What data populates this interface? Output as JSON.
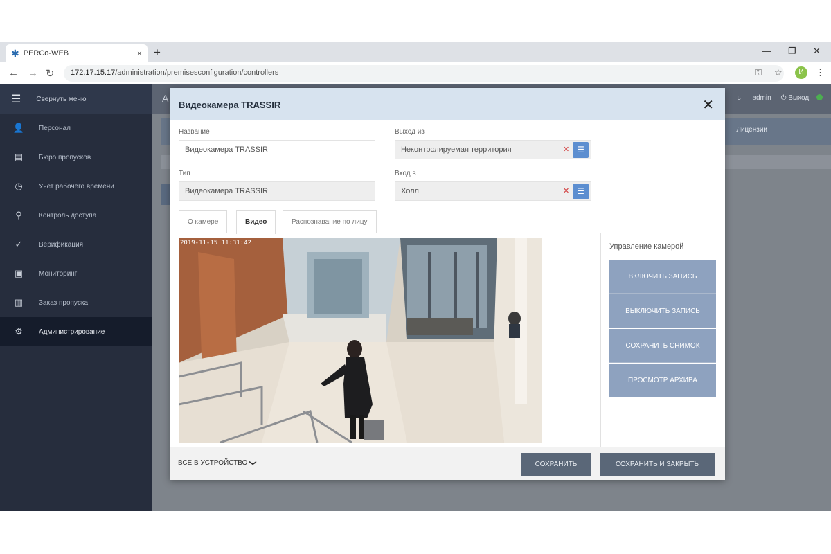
{
  "browser": {
    "tab_title": "PERCo-WEB",
    "tab_close": "×",
    "new_tab": "+",
    "url_host": "172.17.15.17",
    "url_path": "/administration/premisesconfiguration/controllers",
    "profile_initial": "И"
  },
  "sidebar": {
    "collapse_label": "Свернуть меню",
    "items": [
      {
        "label": "Персонал",
        "icon": "person-icon"
      },
      {
        "label": "Бюро пропусков",
        "icon": "pass-office-icon"
      },
      {
        "label": "Учет рабочего времени",
        "icon": "clock-icon"
      },
      {
        "label": "Контроль доступа",
        "icon": "key-icon"
      },
      {
        "label": "Верификация",
        "icon": "verify-icon"
      },
      {
        "label": "Мониторинг",
        "icon": "monitor-icon"
      },
      {
        "label": "Заказ пропуска",
        "icon": "order-pass-icon"
      },
      {
        "label": "Администрирование",
        "icon": "gear-icon",
        "active": true
      }
    ]
  },
  "app_header": {
    "crumb_initial": "А",
    "help_fragment": "ь",
    "user": "admin",
    "logout": "⏻ Выход",
    "licenses": "Лицензии",
    "status_color": "#4caf50"
  },
  "modal": {
    "title": "Видеокамера TRASSIR",
    "name_label": "Название",
    "name_value": "Видеокамера TRASSIR",
    "type_label": "Тип",
    "type_value": "Видеокамера TRASSIR",
    "exit_label": "Выход из",
    "exit_value": "Неконтролируемая территория",
    "entry_label": "Вход в",
    "entry_value": "Холл",
    "tabs": [
      "О камере",
      "Видео",
      "Распознавание по лицу"
    ],
    "active_tab": "Видео",
    "video_timestamp": "2019-11-15  11:31:42",
    "camera_control_title": "Управление камерой",
    "camera_buttons": [
      "ВКЛЮЧИТЬ ЗАПИСЬ",
      "ВЫКЛЮЧИТЬ ЗАПИСЬ",
      "СОХРАНИТЬ СНИМОК",
      "ПРОСМОТР АРХИВА"
    ],
    "all_devices_label": "ВСЕ В УСТРОЙСТВО",
    "save_label": "СОХРАНИТЬ",
    "save_close_label": "СОХРАНИТЬ И ЗАКРЫТЬ"
  },
  "colors": {
    "sidebar_bg": "#262d3d",
    "modal_header_bg": "#d7e3ef",
    "camera_button_bg": "#8ea2bf",
    "save_button_bg": "#5a6778",
    "picker_button_bg": "#5c8ed0"
  }
}
